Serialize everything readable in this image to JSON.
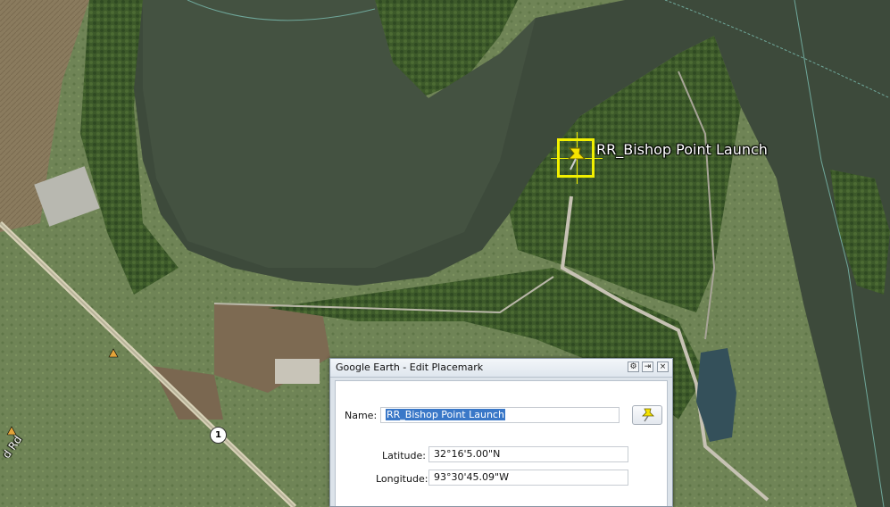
{
  "map": {
    "placemark_label": "RR_Bishop Point Launch",
    "road_label": "d Rd",
    "route_number": "1"
  },
  "dialog": {
    "title": "Google Earth - Edit Placemark",
    "name_label": "Name:",
    "name_value": "RR_Bishop Point Launch",
    "latitude_label": "Latitude:",
    "latitude_value": "32°16'5.00\"N",
    "longitude_label": "Longitude:",
    "longitude_value": "93°30'45.09\"W",
    "title_buttons": [
      "gear-icon",
      "pin-icon",
      "close-icon"
    ]
  },
  "colors": {
    "lake": "#3d4a3b",
    "placemark_highlight": "#f2f000",
    "selection": "#3a78c8"
  }
}
